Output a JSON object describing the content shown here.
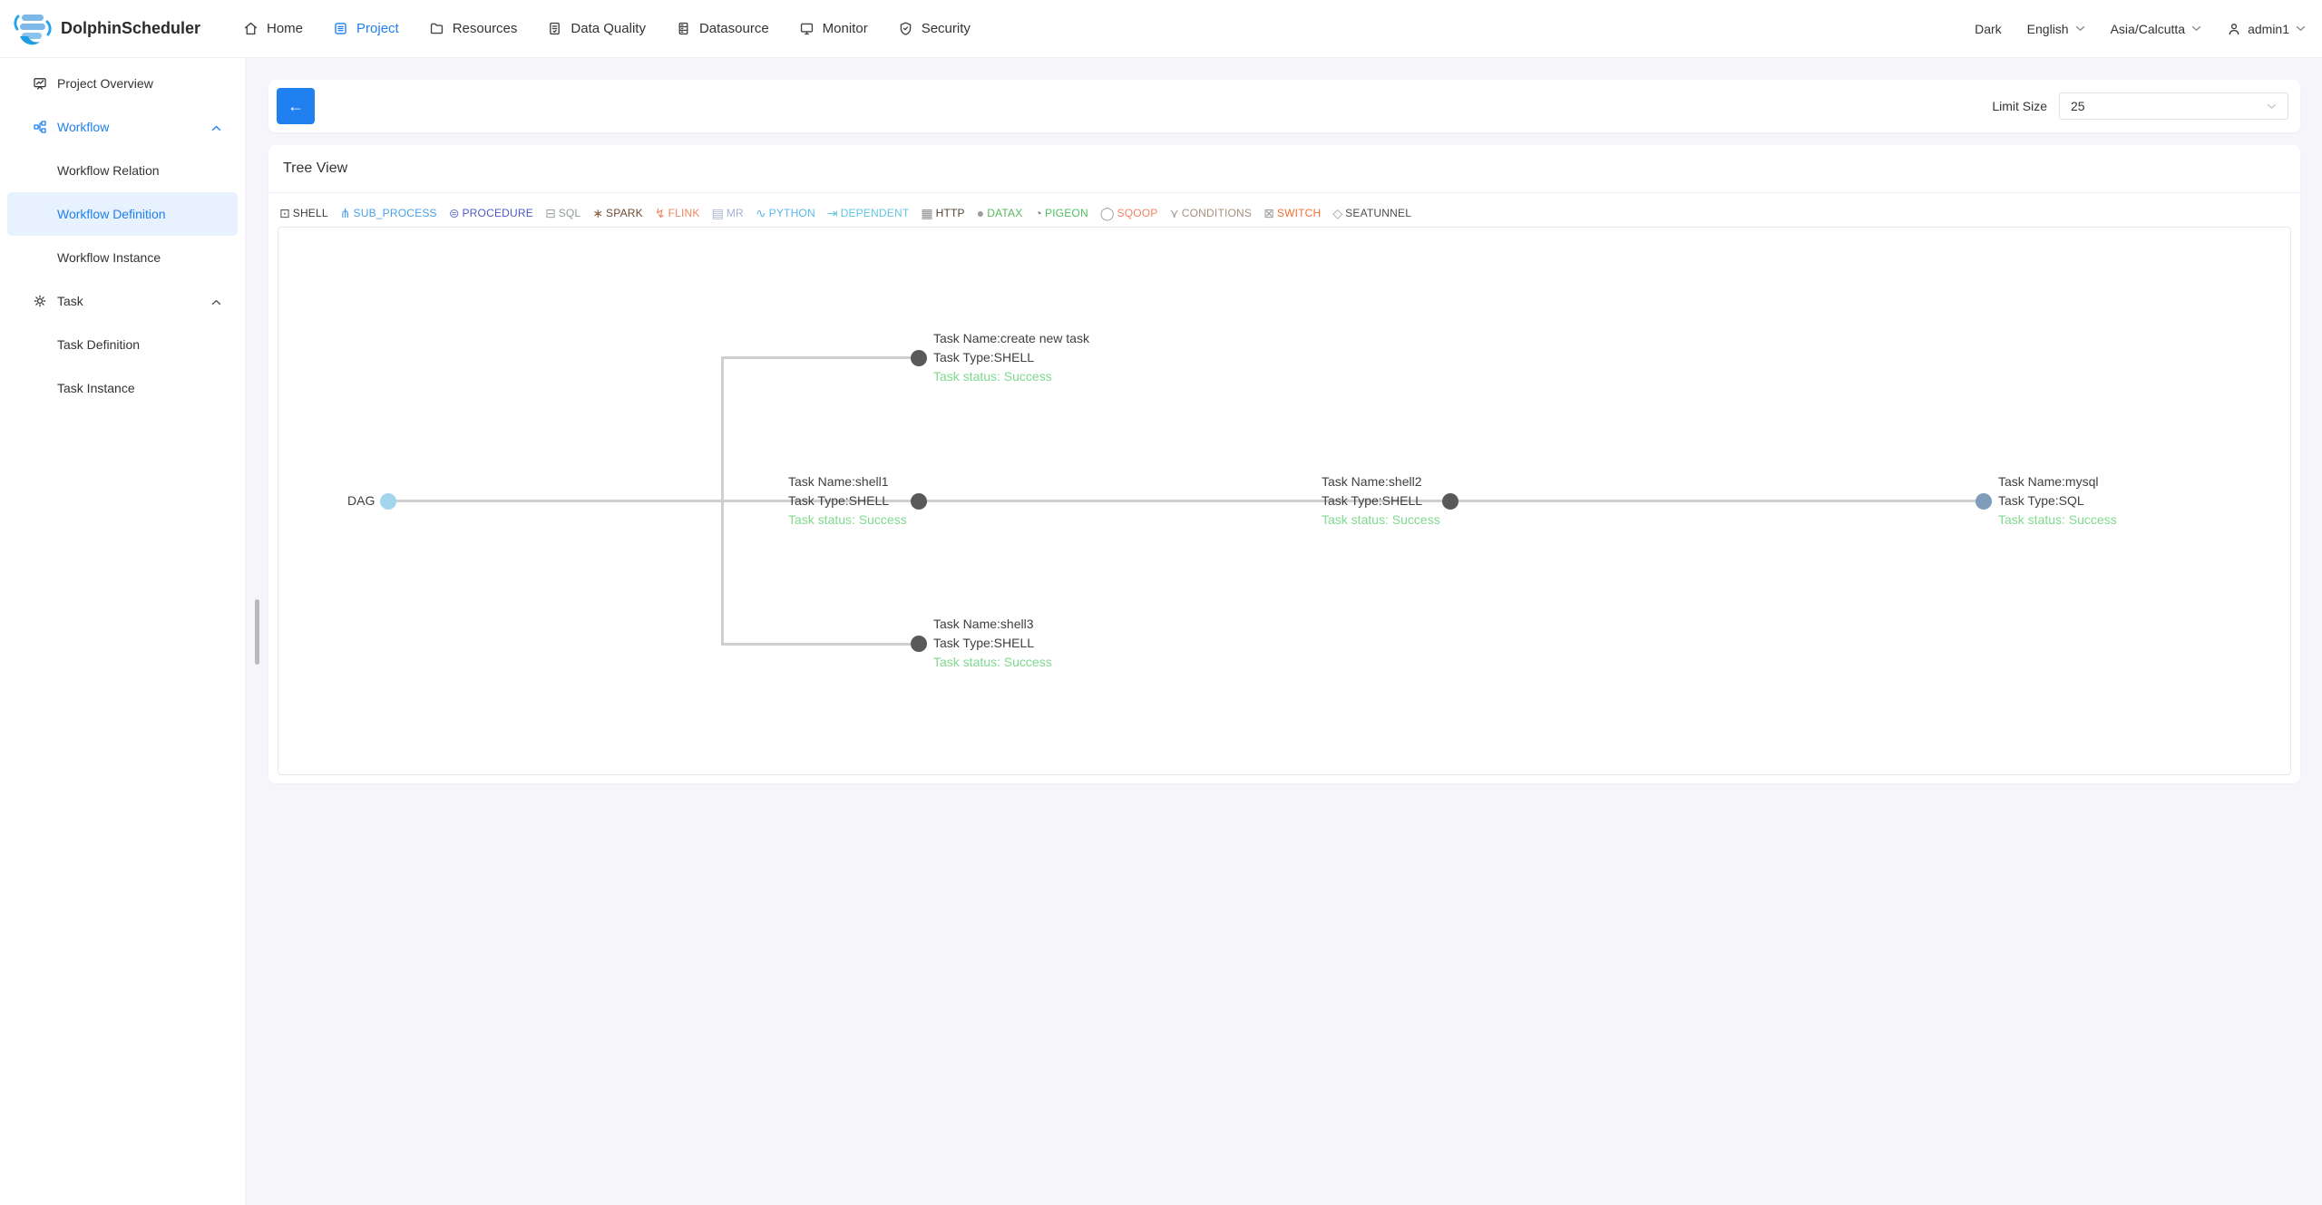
{
  "navbar": {
    "brand": "DolphinScheduler",
    "items": [
      {
        "label": "Home",
        "active": false
      },
      {
        "label": "Project",
        "active": true
      },
      {
        "label": "Resources",
        "active": false
      },
      {
        "label": "Data Quality",
        "active": false
      },
      {
        "label": "Datasource",
        "active": false
      },
      {
        "label": "Monitor",
        "active": false
      },
      {
        "label": "Security",
        "active": false
      }
    ],
    "theme_label": "Dark",
    "language": "English",
    "timezone": "Asia/Calcutta",
    "username": "admin1"
  },
  "sidebar": {
    "items": [
      {
        "label": "Project Overview"
      },
      {
        "label": "Workflow"
      },
      {
        "label": "Workflow Relation"
      },
      {
        "label": "Workflow Definition"
      },
      {
        "label": "Workflow Instance"
      },
      {
        "label": "Task"
      },
      {
        "label": "Task Definition"
      },
      {
        "label": "Task Instance"
      }
    ]
  },
  "toolbar": {
    "back_icon": "←",
    "limit_size_label": "Limit Size",
    "limit_size_value": "25"
  },
  "tree_view": {
    "title": "Tree View",
    "legend": [
      {
        "label": "SHELL",
        "color": "#3b3b3b",
        "icon_color": "#555555",
        "glyph": "⊡"
      },
      {
        "label": "SUB_PROCESS",
        "color": "#489fe8",
        "icon_color": "#489fe8",
        "glyph": "⋔"
      },
      {
        "label": "PROCEDURE",
        "color": "#4d5ac6",
        "icon_color": "#6b79ce",
        "glyph": "⊜"
      },
      {
        "label": "SQL",
        "color": "#8e9c9c",
        "icon_color": "#9aa4a8",
        "glyph": "⊟"
      },
      {
        "label": "SPARK",
        "color": "#6c4a35",
        "icon_color": "#8a5f43",
        "glyph": "∗"
      },
      {
        "label": "FLINK",
        "color": "#ee8562",
        "icon_color": "#ee8562",
        "glyph": "↯"
      },
      {
        "label": "MR",
        "color": "#a2b2d4",
        "icon_color": "#a5b3d4",
        "glyph": "▤"
      },
      {
        "label": "PYTHON",
        "color": "#59b8ef",
        "icon_color": "#62b5e5",
        "glyph": "∿"
      },
      {
        "label": "DEPENDENT",
        "color": "#62c4e3",
        "icon_color": "#6cc5de",
        "glyph": "⇥"
      },
      {
        "label": "HTTP",
        "color": "#514535",
        "icon_color": "#8c8c8c",
        "glyph": "▦"
      },
      {
        "label": "DATAX",
        "color": "#56b95f",
        "icon_color": "#9c9c9c",
        "glyph": "●"
      },
      {
        "label": "PIGEON",
        "color": "#52bf61",
        "icon_color": "#8c8c8c",
        "glyph": "◔"
      },
      {
        "label": "SQOOP",
        "color": "#ee8465",
        "icon_color": "#9c9c9c",
        "glyph": "◯"
      },
      {
        "label": "CONDITIONS",
        "color": "#a4917d",
        "icon_color": "#9c9c9c",
        "glyph": "⋎"
      },
      {
        "label": "SWITCH",
        "color": "#f66e32",
        "icon_color": "#9c9c9c",
        "glyph": "⊠"
      },
      {
        "label": "SEATUNNEL",
        "color": "#4d4d4d",
        "icon_color": "#9c9c9c",
        "glyph": "◇"
      }
    ]
  },
  "chart_data": {
    "type": "tree",
    "root_label": "DAG",
    "root_color": "#a3d6ec",
    "edge_color": "#cfcfcf",
    "success_color": "#7fd98e",
    "nodes": [
      {
        "id": "create new task",
        "task_type": "SHELL",
        "status": "Success",
        "color": "#595959",
        "name_line": "Task Name:create new task",
        "type_line": "Task Type:SHELL",
        "status_line": "Task status: Success"
      },
      {
        "id": "shell1",
        "task_type": "SHELL",
        "status": "Success",
        "color": "#595959",
        "name_line": "Task Name:shell1",
        "type_line": "Task Type:SHELL",
        "status_line": "Task status: Success"
      },
      {
        "id": "shell2",
        "task_type": "SHELL",
        "status": "Success",
        "color": "#595959",
        "name_line": "Task Name:shell2",
        "type_line": "Task Type:SHELL",
        "status_line": "Task status: Success"
      },
      {
        "id": "mysql",
        "task_type": "SQL",
        "status": "Success",
        "color": "#7e9dbb",
        "name_line": "Task Name:mysql",
        "type_line": "Task Type:SQL",
        "status_line": "Task status: Success"
      },
      {
        "id": "shell3",
        "task_type": "SHELL",
        "status": "Success",
        "color": "#595959",
        "name_line": "Task Name:shell3",
        "type_line": "Task Type:SHELL",
        "status_line": "Task status: Success"
      }
    ],
    "edges": [
      [
        "DAG",
        "create new task"
      ],
      [
        "DAG",
        "shell1"
      ],
      [
        "DAG",
        "shell3"
      ],
      [
        "shell1",
        "shell2"
      ],
      [
        "shell2",
        "mysql"
      ]
    ]
  }
}
